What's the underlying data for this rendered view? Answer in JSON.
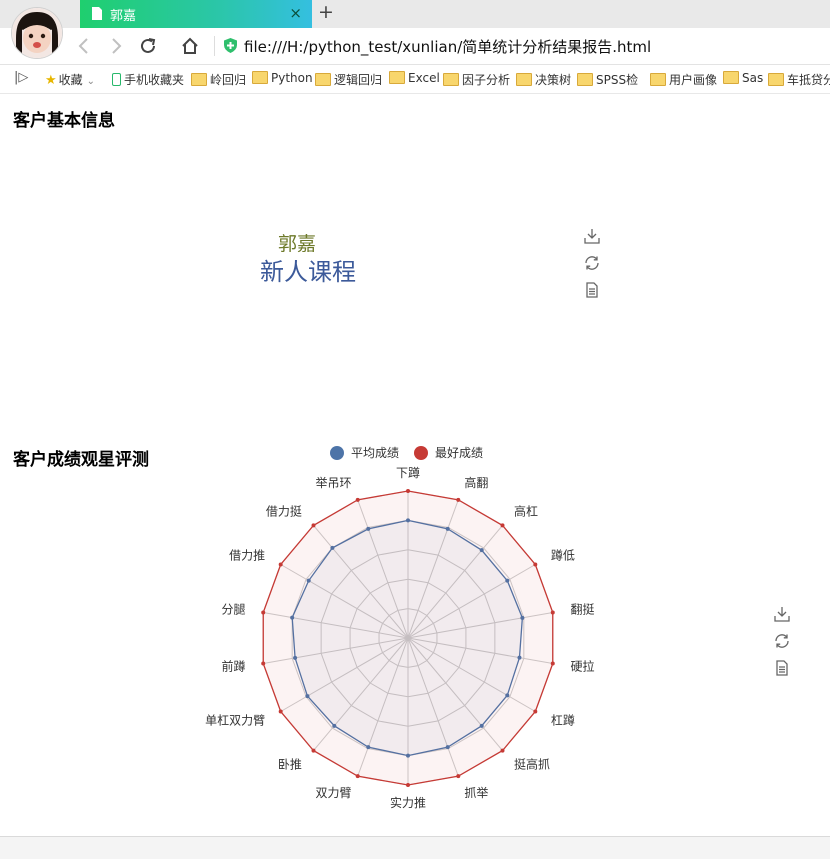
{
  "browser": {
    "tab_title": "郭嘉",
    "tab_close": "×",
    "new_tab": "+",
    "url": "file:///H:/python_test/xunlian/简单统计分析结果报告.html",
    "bookmarks": [
      {
        "label": "收藏",
        "icon": "star-icon"
      },
      {
        "label": "手机收藏夹",
        "icon": "phone-icon"
      },
      {
        "label": "岭回归",
        "icon": "folder-icon"
      },
      {
        "label": "Python",
        "icon": "folder-icon"
      },
      {
        "label": "逻辑回归",
        "icon": "folder-icon"
      },
      {
        "label": "Excel",
        "icon": "folder-icon"
      },
      {
        "label": "因子分析",
        "icon": "folder-icon"
      },
      {
        "label": "决策树",
        "icon": "folder-icon"
      },
      {
        "label": "SPSS检",
        "icon": "folder-icon"
      },
      {
        "label": "用户画像",
        "icon": "folder-icon"
      },
      {
        "label": "Sas",
        "icon": "folder-icon"
      },
      {
        "label": "车抵贷分",
        "icon": "folder-icon"
      }
    ]
  },
  "page": {
    "section1_title": "客户基本信息",
    "section2_title": "客户成绩观星评测",
    "customer_name": "郭嘉",
    "course": "新人课程"
  },
  "colors": {
    "avg_series": "#4d74a8",
    "best_series": "#c63a35",
    "grid": "#cccccc"
  },
  "chart_data": {
    "type": "radar",
    "indicators": [
      "下蹲",
      "高翻",
      "高杠",
      "蹲低",
      "翻挺",
      "硬拉",
      "杠蹲",
      "挺高抓",
      "抓举",
      "实力推",
      "双力臂",
      "卧推",
      "单杠双力臂",
      "前蹲",
      "分腿",
      "借力推",
      "借力挺",
      "举吊环"
    ],
    "max": 100,
    "grid_levels": 5,
    "legend_position": "top-center",
    "series": [
      {
        "name": "平均成绩",
        "values": [
          80,
          79,
          78,
          78,
          79,
          77,
          78,
          78,
          79,
          80,
          79,
          78,
          79,
          78,
          80,
          78,
          80,
          79
        ]
      },
      {
        "name": "最好成绩",
        "values": [
          100,
          100,
          100,
          100,
          100,
          100,
          100,
          100,
          100,
          100,
          100,
          100,
          100,
          100,
          100,
          100,
          100,
          100
        ]
      }
    ]
  },
  "toolbox_titles": [
    "保存为图片",
    "还原",
    "数据视图"
  ]
}
